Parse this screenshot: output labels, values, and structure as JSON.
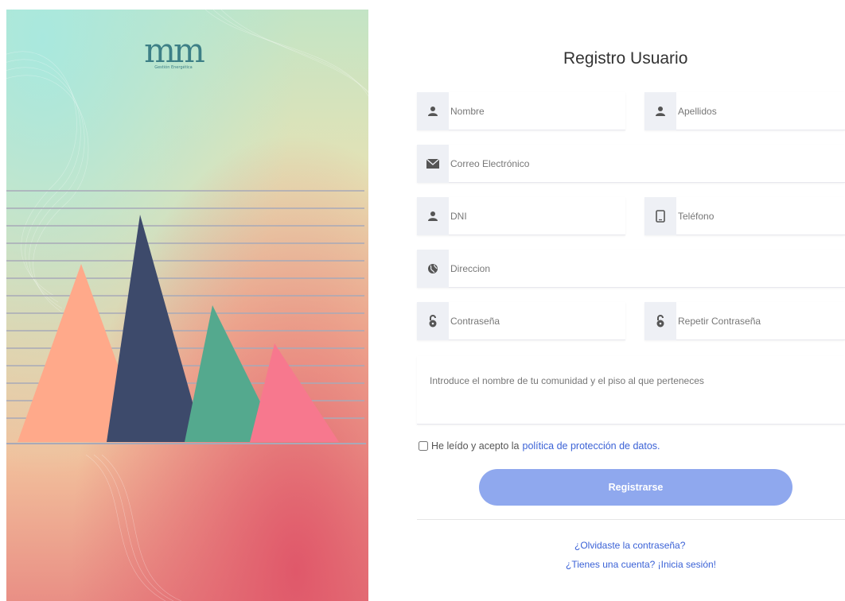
{
  "brand": {
    "logo_text": "mm",
    "logo_subtitle": "Gestión Energética"
  },
  "form": {
    "title": "Registro Usuario",
    "fields": {
      "nombre": {
        "placeholder": "Nombre",
        "icon": "user-icon"
      },
      "apellidos": {
        "placeholder": "Apellidos",
        "icon": "user-icon"
      },
      "correo": {
        "placeholder": "Correo Electrónico",
        "icon": "envelope-icon"
      },
      "dni": {
        "placeholder": "DNI",
        "icon": "user-icon"
      },
      "telefono": {
        "placeholder": "Teléfono",
        "icon": "phone-icon"
      },
      "direccion": {
        "placeholder": "Direccion",
        "icon": "globe-icon"
      },
      "contrasena": {
        "placeholder": "Contraseña",
        "icon": "lock-icon"
      },
      "repetir": {
        "placeholder": "Repetir Contraseña",
        "icon": "lock-icon"
      },
      "comunidad": {
        "placeholder": "Introduce el nombre de tu comunidad y el piso al que perteneces"
      }
    },
    "consent": {
      "text": "He leído y acepto la",
      "link": "política de protección de datos."
    },
    "register_label": "Registrarse",
    "forgot_link": "¿Olvidaste la contraseña?",
    "login_link": "¿Tienes una cuenta? ¡Inicia sesión!"
  },
  "colors": {
    "accent": "#3b62d6",
    "button": "#8fa8ee",
    "triangle_salmon": "#ffa98a",
    "triangle_navy": "#3d4a6b",
    "triangle_green": "#54a98e",
    "triangle_pink": "#f7788e"
  }
}
